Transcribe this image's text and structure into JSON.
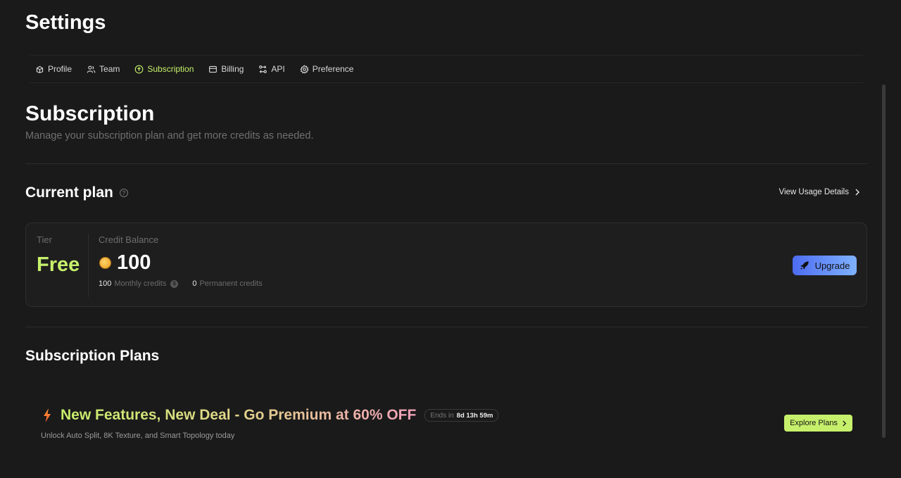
{
  "header": {
    "title": "Settings"
  },
  "tabs": [
    {
      "label": "Profile",
      "icon": "profile-icon",
      "active": false
    },
    {
      "label": "Team",
      "icon": "team-icon",
      "active": false
    },
    {
      "label": "Subscription",
      "icon": "subscription-icon",
      "active": true
    },
    {
      "label": "Billing",
      "icon": "billing-icon",
      "active": false
    },
    {
      "label": "API",
      "icon": "api-icon",
      "active": false
    },
    {
      "label": "Preference",
      "icon": "gear-icon",
      "active": false
    }
  ],
  "subscription": {
    "title": "Subscription",
    "subtitle": "Manage your subscription plan and get more credits as needed."
  },
  "current_plan": {
    "heading": "Current plan",
    "view_usage_label": "View Usage Details",
    "tier_label": "Tier",
    "tier_value": "Free",
    "credit_label": "Credit Balance",
    "credit_value": "100",
    "monthly_credits": "100",
    "monthly_label": "Monthly credits",
    "permanent_credits": "0",
    "permanent_label": "Permanent credits",
    "upgrade_label": "Upgrade"
  },
  "plans": {
    "heading": "Subscription Plans",
    "promo_title": "New Features, New Deal - Go Premium at 60% OFF",
    "ends_label": "Ends in",
    "countdown": "8d 13h 59m",
    "promo_subtitle": "Unlock Auto Split, 8K Texture, and Smart Topology today",
    "explore_label": "Explore Plans"
  },
  "colors": {
    "background": "#1a1a1a",
    "accent": "#c6f06b",
    "upgrade_gradient_start": "#4d6cf0",
    "upgrade_gradient_end": "#7fb2ff"
  }
}
